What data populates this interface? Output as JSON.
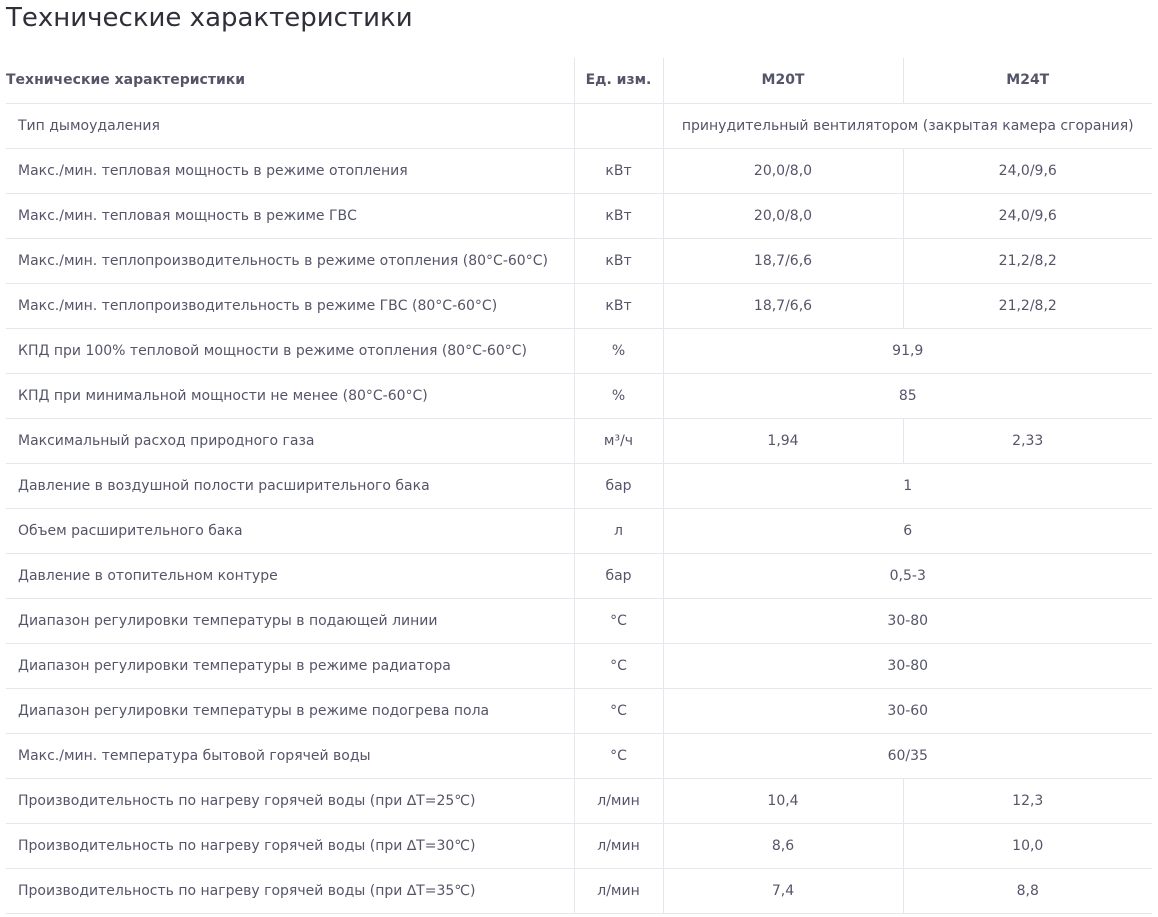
{
  "page": {
    "title": "Технические характеристики"
  },
  "table": {
    "headers": {
      "name": "Технические характеристики",
      "unit": "Ед. изм.",
      "m20": "M20T",
      "m24": "M24T"
    },
    "rows": [
      {
        "name": "Тип дымоудаления",
        "unit": "",
        "merged": "принудительный вентилятором (закрытая камера сгорания)"
      },
      {
        "name": "Макс./мин. тепловая мощность в режиме отопления",
        "unit": "кВт",
        "m20": "20,0/8,0",
        "m24": "24,0/9,6"
      },
      {
        "name": "Макс./мин. тепловая мощность в режиме ГВС",
        "unit": "кВт",
        "m20": "20,0/8,0",
        "m24": "24,0/9,6"
      },
      {
        "name": "Макс./мин. теплопроизводительность в режиме отопления (80°С-60°С)",
        "unit": "кВт",
        "m20": "18,7/6,6",
        "m24": "21,2/8,2"
      },
      {
        "name": "Макс./мин. теплопроизводительность в режиме ГВС (80°С-60°С)",
        "unit": "кВт",
        "m20": "18,7/6,6",
        "m24": "21,2/8,2"
      },
      {
        "name": "КПД при 100% тепловой мощности в режиме отопления (80°С-60°С)",
        "unit": "%",
        "merged": "91,9"
      },
      {
        "name": "КПД при минимальной мощности не менее (80°С-60°С)",
        "unit": "%",
        "merged": "85"
      },
      {
        "name": "Максимальный  расход природного газа",
        "unit": "м³/ч",
        "m20": "1,94",
        "m24": "2,33"
      },
      {
        "name": "Давление в воздушной полости расширительного бака",
        "unit": "бар",
        "merged": "1"
      },
      {
        "name": "Объем расширительного бака",
        "unit": "л",
        "merged": "6"
      },
      {
        "name": "Давление в отопительном контуре",
        "unit": "бар",
        "merged": "0,5-3"
      },
      {
        "name": "Диапазон регулировки температуры в подающей линии",
        "unit": "°С",
        "merged": "30-80"
      },
      {
        "name": "Диапазон регулировки температуры в режиме радиатора",
        "unit": "°С",
        "merged": "30-80"
      },
      {
        "name": "Диапазон регулировки температуры в режиме подогрева пола",
        "unit": "°С",
        "merged": "30-60"
      },
      {
        "name": "Макс./мин. температура бытовой горячей воды",
        "unit": "°С",
        "merged": "60/35"
      },
      {
        "name": "Производительность по нагреву горячей воды   (при ∆T=25℃)",
        "unit": "л/мин",
        "m20": "10,4",
        "m24": "12,3"
      },
      {
        "name": "Производительность по нагреву горячей воды  (при ∆T=30℃)",
        "unit": "л/мин",
        "m20": "8,6",
        "m24": "10,0"
      },
      {
        "name": "Производительность по нагреву горячей воды  (при ∆T=35℃)",
        "unit": "л/мин",
        "m20": "7,4",
        "m24": "8,8"
      }
    ]
  }
}
